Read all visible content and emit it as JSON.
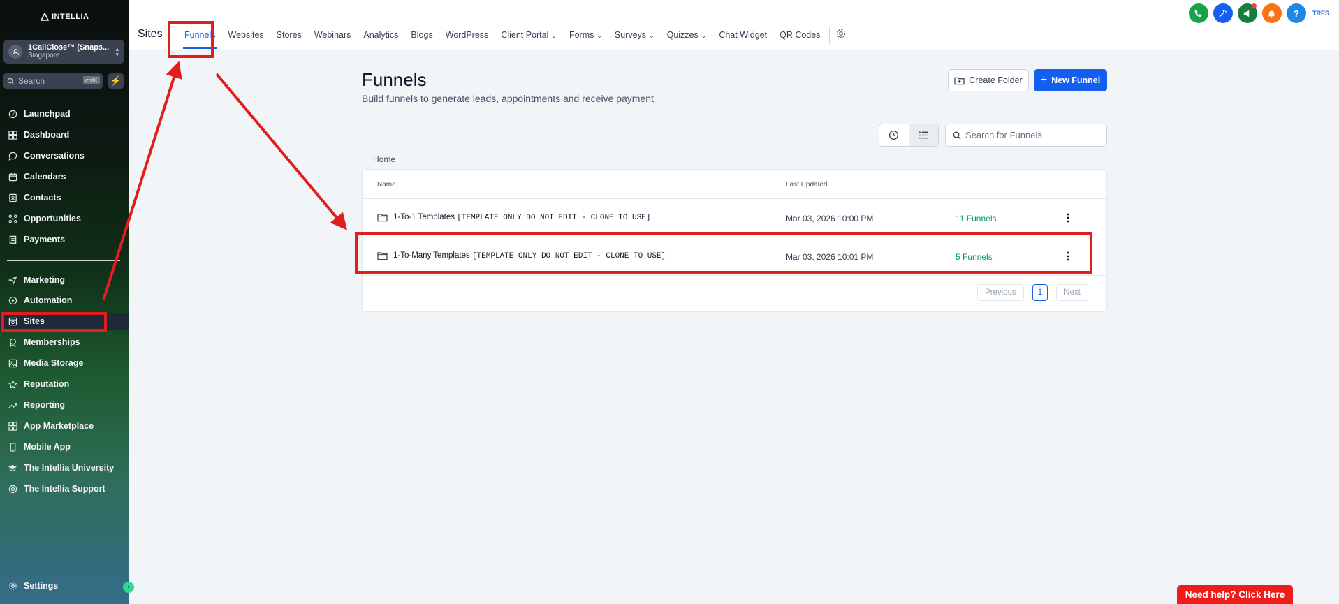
{
  "brand": {
    "name": "INTELLIA"
  },
  "account": {
    "name": "1CallClose™ (Snaps...",
    "location": "Singapore"
  },
  "sidebar": {
    "search_placeholder": "Search",
    "search_shortcut": "ctrlK",
    "items": [
      {
        "label": "Launchpad",
        "icon": "launchpad-icon"
      },
      {
        "label": "Dashboard",
        "icon": "dashboard-icon"
      },
      {
        "label": "Conversations",
        "icon": "chat-icon"
      },
      {
        "label": "Calendars",
        "icon": "calendar-icon"
      },
      {
        "label": "Contacts",
        "icon": "contacts-icon"
      },
      {
        "label": "Opportunities",
        "icon": "opportunities-icon"
      },
      {
        "label": "Payments",
        "icon": "payments-icon"
      },
      {
        "label": "Marketing",
        "icon": "send-icon"
      },
      {
        "label": "Automation",
        "icon": "automation-icon"
      },
      {
        "label": "Sites",
        "icon": "sites-icon"
      },
      {
        "label": "Memberships",
        "icon": "award-icon"
      },
      {
        "label": "Media Storage",
        "icon": "image-icon"
      },
      {
        "label": "Reputation",
        "icon": "star-icon"
      },
      {
        "label": "Reporting",
        "icon": "trend-icon"
      },
      {
        "label": "App Marketplace",
        "icon": "grid-icon"
      },
      {
        "label": "Mobile App",
        "icon": "mobile-icon"
      },
      {
        "label": "The Intellia University",
        "icon": "graduation-icon"
      },
      {
        "label": "The Intellia Support",
        "icon": "support-icon"
      }
    ],
    "settings": "Settings"
  },
  "topbar": {
    "section": "Sites",
    "tabs": [
      "Funnels",
      "Websites",
      "Stores",
      "Webinars",
      "Analytics",
      "Blogs",
      "WordPress",
      "Client Portal",
      "Forms",
      "Surveys",
      "Quizzes",
      "Chat Widget",
      "QR Codes"
    ],
    "user_initials": "TRES"
  },
  "main": {
    "title": "Funnels",
    "subtitle": "Build funnels to generate leads, appointments and receive payment",
    "create_folder": "Create Folder",
    "new_funnel": "New Funnel",
    "search_placeholder": "Search for Funnels",
    "breadcrumb": "Home",
    "columns": {
      "name": "Name",
      "updated": "Last Updated"
    },
    "rows": [
      {
        "name": "1-To-1 Templates",
        "note": "[TEMPLATE ONLY DO NOT EDIT - CLONE TO USE]",
        "updated": "Mar 03, 2026 10:00 PM",
        "count": "11 Funnels"
      },
      {
        "name": "1-To-Many Templates",
        "note": "[TEMPLATE ONLY DO NOT EDIT - CLONE TO USE]",
        "updated": "Mar 03, 2026 10:01 PM",
        "count": "5 Funnels"
      }
    ],
    "pager": {
      "prev": "Previous",
      "page": "1",
      "next": "Next"
    }
  },
  "help": "Need help? Click Here",
  "colors": {
    "accent": "#155eef",
    "success": "#039855",
    "highlight": "#e11d1d"
  }
}
